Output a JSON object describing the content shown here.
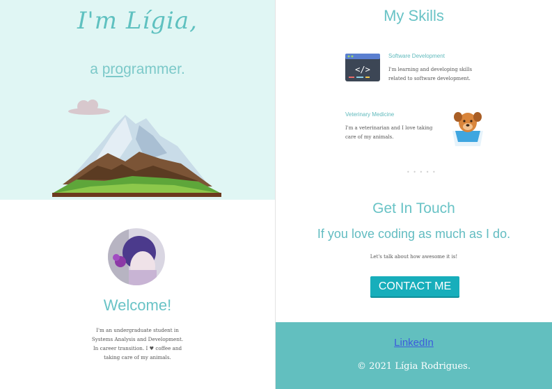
{
  "hero": {
    "title": "I'm Lígia,",
    "subtitle_prefix": "a ",
    "subtitle_underlined": "pro",
    "subtitle_rest": "grammer."
  },
  "profile": {
    "welcome": "Welcome!",
    "about": "I'm an undergraduate student in Systems Analysis and Development. In career transition. I ♥ coffee and taking care of my animals."
  },
  "skills": {
    "title": "My Skills",
    "items": [
      {
        "name": "Software Development",
        "description": "I'm learning and developing skills related to software development.",
        "icon": "code-window-icon"
      },
      {
        "name": "Veterinary Medicine",
        "description": "I'm a veterinarian and I love taking care of my animals.",
        "icon": "dog-cone-icon"
      }
    ],
    "separator": "• • • • •"
  },
  "contact": {
    "title": "Get In Touch",
    "subtitle": "If you love coding as much as I do.",
    "note": "Let's talk about how awesome it is!",
    "button_label": "CONTACT ME"
  },
  "footer": {
    "linkedin_label": "LinkedIn",
    "copyright": "© 2021 Lígia Rodrigues."
  },
  "colors": {
    "hero_bg": "#e0f6f4",
    "accent": "#69c3c6",
    "button": "#17aebb",
    "footer_bg": "#62bfbf"
  }
}
